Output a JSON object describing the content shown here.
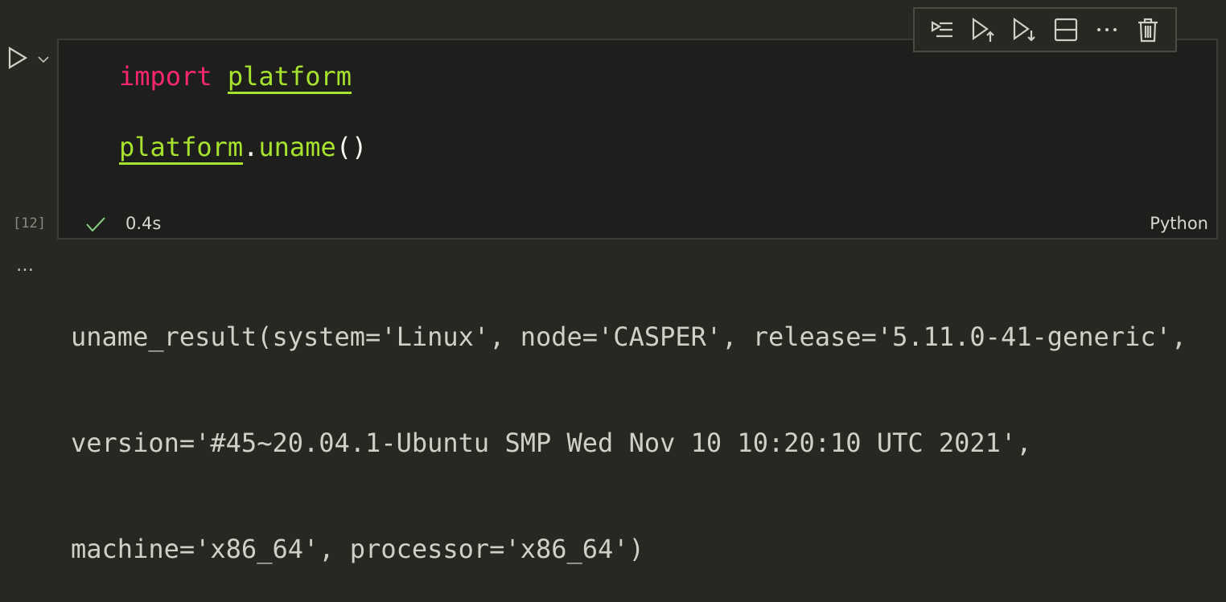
{
  "cell": {
    "execution_count": "[12]",
    "status_icon": "check-icon",
    "duration": "0.4s",
    "language": "Python",
    "code": {
      "line1_keyword": "import",
      "line1_module": "platform",
      "line2_module": "platform",
      "line2_dot": ".",
      "line2_func": "uname",
      "line2_parens": "()"
    }
  },
  "toolbar": {
    "icons": [
      "execute-above-icon",
      "run-up-icon",
      "run-down-icon",
      "split-cell-icon",
      "more-icon",
      "delete-icon"
    ]
  },
  "output": {
    "ellipsis": "…",
    "lines": [
      "uname_result(system='Linux', node='CASPER', release='5.11.0-41-generic',",
      "version='#45~20.04.1-Ubuntu SMP Wed Nov 10 10:20:10 UTC 2021',",
      "machine='x86_64', processor='x86_64')"
    ]
  },
  "colors": {
    "keyword": "#f92672",
    "identifier": "#a6e22e",
    "success": "#89d185"
  }
}
